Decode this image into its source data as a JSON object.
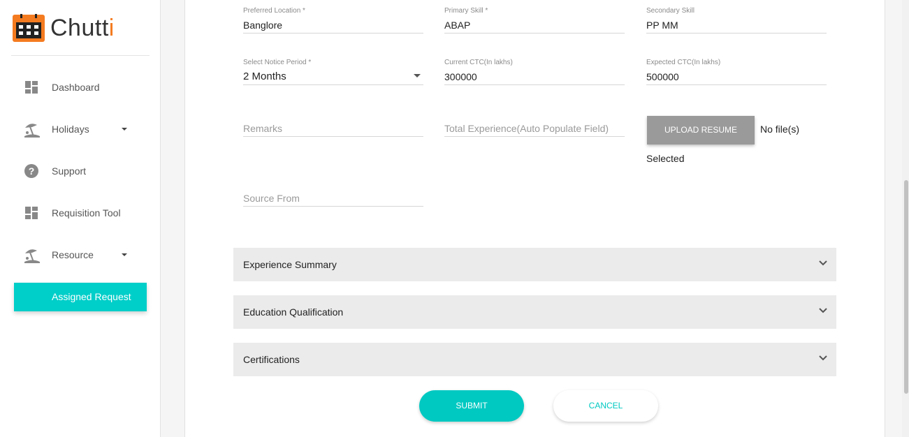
{
  "app": {
    "name_main": "Chutt",
    "name_accent": "i",
    "brand_color": "#f47b20",
    "accent_color": "#00cec9"
  },
  "sidebar": {
    "items": [
      {
        "label": "Dashboard",
        "icon": "dashboard-icon"
      },
      {
        "label": "Holidays",
        "icon": "beach-icon",
        "has_dropdown": true
      },
      {
        "label": "Support",
        "icon": "help-icon"
      },
      {
        "label": "Requisition Tool",
        "icon": "dashboard-icon"
      },
      {
        "label": "Resource",
        "icon": "beach-icon",
        "has_dropdown": true
      }
    ],
    "active_button": "Assigned Request"
  },
  "form": {
    "preferred_location": {
      "label": "Preferred Location *",
      "value": "Banglore"
    },
    "primary_skill": {
      "label": "Primary Skill *",
      "value": "ABAP"
    },
    "secondary_skill": {
      "label": "Secondary Skill",
      "value": "PP MM"
    },
    "notice_period": {
      "label": "Select Notice Period *",
      "value": "2 Months"
    },
    "current_ctc": {
      "label": "Current CTC(In lakhs)",
      "value": "300000"
    },
    "expected_ctc": {
      "label": "Expected CTC(In lakhs)",
      "value": "500000"
    },
    "remarks": {
      "placeholder": "Remarks"
    },
    "total_experience": {
      "placeholder": "Total Experience(Auto Populate Field)"
    },
    "source_from": {
      "placeholder": "Source From"
    },
    "upload": {
      "button": "UPLOAD RESUME",
      "status_line1": "No file(s)",
      "status_line2": "Selected"
    }
  },
  "accordions": [
    {
      "title": "Experience Summary"
    },
    {
      "title": "Education Qualification"
    },
    {
      "title": "Certifications"
    }
  ],
  "actions": {
    "submit": "SUBMIT",
    "cancel": "CANCEL"
  }
}
